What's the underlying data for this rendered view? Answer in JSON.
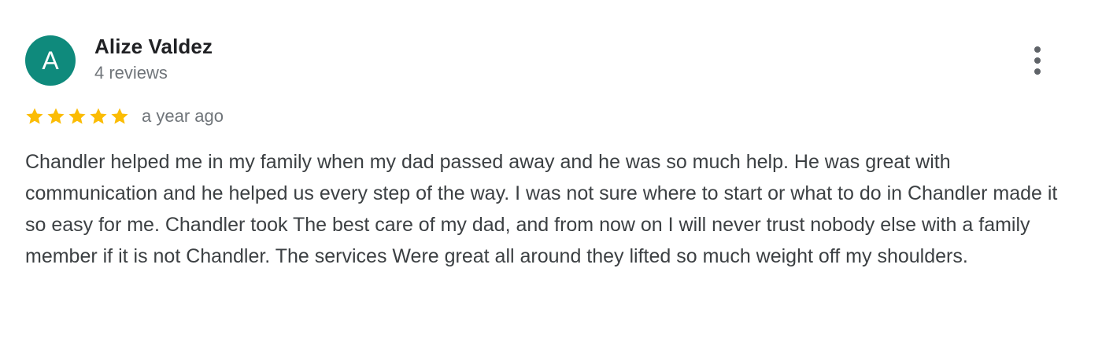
{
  "review": {
    "avatar_letter": "A",
    "avatar_color": "#0f8a7c",
    "author_name": "Alize Valdez",
    "author_meta": "4 reviews",
    "more_options_icon": "more-vert-icon",
    "rating": 5,
    "rating_max": 5,
    "star_icon": "star-icon",
    "star_color": "#fbbc04",
    "date": "a year ago",
    "text": "Chandler helped me in my family when my dad passed away and he was so much help. He was great with communication and he helped us every step of the way. I was not sure where to start or what to do in Chandler made it so easy for me. Chandler took The best care of my dad, and from now on I will never trust nobody else with a family member if it is not Chandler. The services Were great all around they lifted so much weight off my shoulders."
  }
}
